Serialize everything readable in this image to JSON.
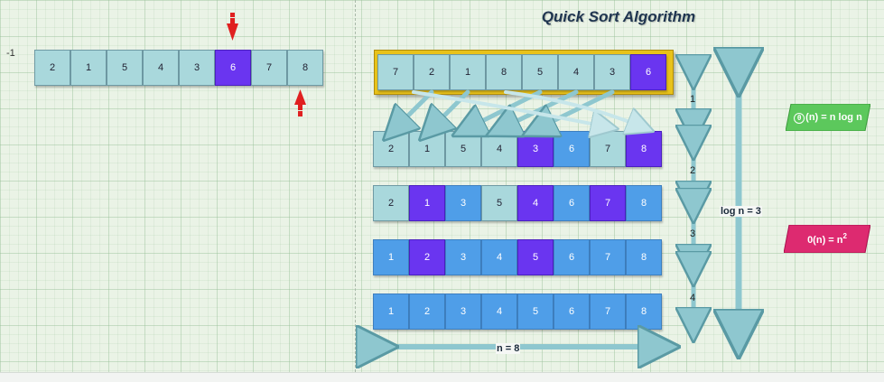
{
  "title": "Quick Sort Algorithm",
  "left_panel": {
    "index_label": "-1",
    "cells": [
      {
        "value": "2",
        "color": "teal"
      },
      {
        "value": "1",
        "color": "teal"
      },
      {
        "value": "5",
        "color": "teal"
      },
      {
        "value": "4",
        "color": "teal"
      },
      {
        "value": "3",
        "color": "teal"
      },
      {
        "value": "6",
        "color": "purple"
      },
      {
        "value": "7",
        "color": "teal"
      },
      {
        "value": "8",
        "color": "teal"
      }
    ],
    "pointer_top": "red-down-arrow-icon",
    "pointer_bottom": "red-up-arrow-icon"
  },
  "top_row": {
    "cells": [
      {
        "value": "7",
        "color": "teal"
      },
      {
        "value": "2",
        "color": "teal"
      },
      {
        "value": "1",
        "color": "teal"
      },
      {
        "value": "8",
        "color": "teal"
      },
      {
        "value": "5",
        "color": "teal"
      },
      {
        "value": "4",
        "color": "teal"
      },
      {
        "value": "3",
        "color": "teal"
      },
      {
        "value": "6",
        "color": "purple"
      }
    ]
  },
  "levels": [
    {
      "label": "1",
      "cells": [
        {
          "value": "2",
          "color": "teal"
        },
        {
          "value": "1",
          "color": "teal"
        },
        {
          "value": "5",
          "color": "teal"
        },
        {
          "value": "4",
          "color": "teal"
        },
        {
          "value": "3",
          "color": "purple"
        },
        {
          "value": "6",
          "color": "blue"
        },
        {
          "value": "7",
          "color": "teal"
        },
        {
          "value": "8",
          "color": "purple"
        }
      ]
    },
    {
      "label": "2",
      "cells": [
        {
          "value": "2",
          "color": "teal"
        },
        {
          "value": "1",
          "color": "purple"
        },
        {
          "value": "3",
          "color": "blue"
        },
        {
          "value": "5",
          "color": "teal"
        },
        {
          "value": "4",
          "color": "purple"
        },
        {
          "value": "6",
          "color": "blue"
        },
        {
          "value": "7",
          "color": "purple"
        },
        {
          "value": "8",
          "color": "blue"
        }
      ]
    },
    {
      "label": "3",
      "cells": [
        {
          "value": "1",
          "color": "blue"
        },
        {
          "value": "2",
          "color": "purple"
        },
        {
          "value": "3",
          "color": "blue"
        },
        {
          "value": "4",
          "color": "blue"
        },
        {
          "value": "5",
          "color": "purple"
        },
        {
          "value": "6",
          "color": "blue"
        },
        {
          "value": "7",
          "color": "blue"
        },
        {
          "value": "8",
          "color": "blue"
        }
      ]
    },
    {
      "label": "4",
      "cells": [
        {
          "value": "1",
          "color": "blue"
        },
        {
          "value": "2",
          "color": "blue"
        },
        {
          "value": "3",
          "color": "blue"
        },
        {
          "value": "4",
          "color": "blue"
        },
        {
          "value": "5",
          "color": "blue"
        },
        {
          "value": "6",
          "color": "blue"
        },
        {
          "value": "7",
          "color": "blue"
        },
        {
          "value": "8",
          "color": "blue"
        }
      ]
    }
  ],
  "log_label": "log n = 3",
  "n_label": "n = 8",
  "complexity": {
    "best": "(n) = n log n",
    "best_symbol": "θ",
    "worst_base": "0(n) = n",
    "worst_exp": "2"
  },
  "colors": {
    "teal": "#a9d8dc",
    "purple": "#6a35f0",
    "blue": "#4f9ee8",
    "frame_yellow": "#e8c21a",
    "badge_green": "#5cc85c",
    "badge_pink": "#dd2a70",
    "pointer_red": "#e02020"
  }
}
